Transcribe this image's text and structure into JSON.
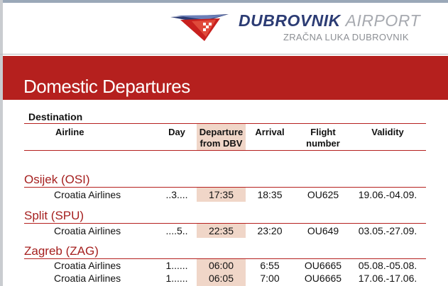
{
  "header": {
    "title_bold": "DUBROVNIK",
    "title_light": "AIRPORT",
    "subtitle": "ZRAČNA LUKA DUBROVNIK"
  },
  "banner": {
    "title": "Domestic Departures"
  },
  "table": {
    "destination_label": "Destination",
    "columns": {
      "airline": "Airline",
      "day": "Day",
      "departure_1": "Departure",
      "departure_2": "from  DBV",
      "arrival": "Arrival",
      "flight_1": "Flight",
      "flight_2": "number",
      "validity": "Validity"
    },
    "groups": [
      {
        "city": "Osijek (OSI)",
        "flights": [
          {
            "airline": "Croatia Airlines",
            "day": "..3....",
            "departure": "17:35",
            "arrival": "18:35",
            "flight": "OU625",
            "validity": "19.06.-04.09."
          }
        ]
      },
      {
        "city": "Split (SPU)",
        "flights": [
          {
            "airline": "Croatia Airlines",
            "day": "....5..",
            "departure": "22:35",
            "arrival": "23:20",
            "flight": "OU649",
            "validity": "03.05.-27.09."
          }
        ]
      },
      {
        "city": "Zagreb (ZAG)",
        "flights": [
          {
            "airline": "Croatia Airlines",
            "day": "1......",
            "departure": "06:00",
            "arrival": "6:55",
            "flight": "OU6665",
            "validity": "05.08.-05.08."
          },
          {
            "airline": "Croatia Airlines",
            "day": "1......",
            "departure": "06:05",
            "arrival": "7:00",
            "flight": "OU6665",
            "validity": "17.06.-17.06."
          }
        ]
      }
    ]
  },
  "colors": {
    "brand_red": "#b5201e",
    "brand_navy": "#2c3c74",
    "highlight": "#f0d6c8"
  }
}
